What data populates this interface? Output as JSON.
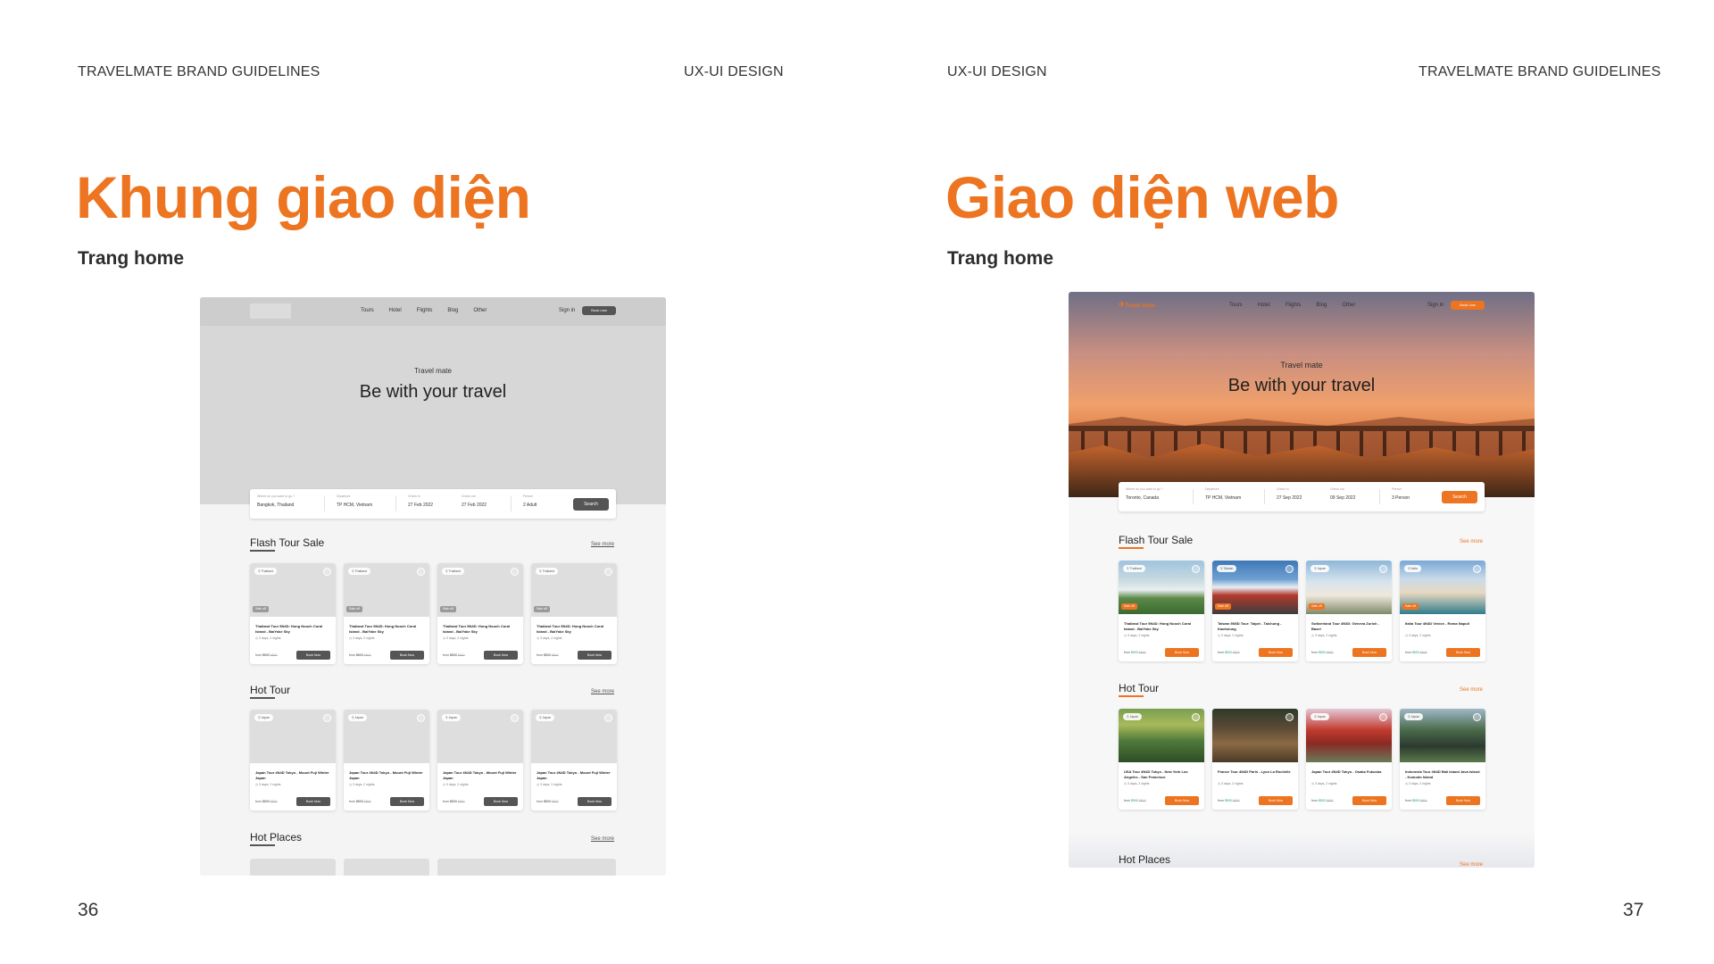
{
  "page": {
    "left": {
      "header_left": "TRAVELMATE BRAND GUIDELINES",
      "header_right": "UX-UI DESIGN",
      "title": "Khung giao diện",
      "subtitle": "Trang home",
      "page_number": "36"
    },
    "right": {
      "header_left": "UX-UI DESIGN",
      "header_right": "TRAVELMATE BRAND GUIDELINES",
      "title": "Giao diện web",
      "subtitle": "Trang home",
      "page_number": "37"
    }
  },
  "colors": {
    "accent": "#ed7420",
    "wire_dark": "#555555",
    "wire_hero": "#d7d7d7"
  },
  "mockup": {
    "nav": {
      "links": [
        "Tours",
        "Hotel",
        "Flights",
        "Blog",
        "Other"
      ],
      "sign_in": "Sign in",
      "book_now": "Book now",
      "logo_text": "Travel mate"
    },
    "hero": {
      "small_title": "Travel mate",
      "big_title": "Be with your travel"
    },
    "search_labels": [
      "Where do you want to go ?",
      "Departure",
      "Check in",
      "Check out",
      "Person"
    ],
    "search_button": "Search",
    "wire_search_values": [
      "Bangkok, Thailand",
      "TP HCM, Vietnam",
      "27 Feb 2022",
      "27 Feb 2022",
      "2 Adult"
    ],
    "web_search_values": [
      "Toronto, Canada",
      "TP HCM, Vietnam",
      "27 Sep 2022",
      "09 Sep 2022",
      "3 Person"
    ],
    "sections": {
      "flash": "Flash Tour Sale",
      "hot_tour": "Hot Tour",
      "hot_places": "Hot Places",
      "see_more": "See more"
    },
    "card_common": {
      "duration": "3 days, 2 nights",
      "from": "from",
      "price": "$500",
      "old_price": "$800",
      "sale": "Sale off",
      "book_btn": "Book Now"
    },
    "wire_flash_cards": [
      {
        "tag": "Thailand",
        "name": "Thailand Tour 5N4D: Hong Nooch Coral Island - BaiYoke Sky"
      },
      {
        "tag": "Thailand",
        "name": "Thailand Tour 5N4D: Hong Nooch Coral Island - BaiYoke Sky"
      },
      {
        "tag": "Thailand",
        "name": "Thailand Tour 5N4D: Hong Nooch Coral Island - BaiYoke Sky"
      },
      {
        "tag": "Thailand",
        "name": "Thailand Tour 5N4D: Hong Nooch Coral Island - BaiYoke Sky"
      }
    ],
    "wire_hot_cards": [
      {
        "tag": "Japan",
        "name": "Japan Tour 4N4D Tokyo - Mount Fuji Winter Japan"
      },
      {
        "tag": "Japan",
        "name": "Japan Tour 4N4D Tokyo - Mount Fuji Winter Japan"
      },
      {
        "tag": "Japan",
        "name": "Japan Tour 4N4D Tokyo - Mount Fuji Winter Japan"
      },
      {
        "tag": "Japan",
        "name": "Japan Tour 4N4D Tokyo - Mount Fuji Winter Japan"
      }
    ],
    "web_flash_cards": [
      {
        "tag": "Thailand",
        "name": "Thailand Tour 5N4D: Hong Nooch Coral Island - BaiYoke Sky",
        "img": "pagoda"
      },
      {
        "tag": "Taiwan",
        "name": "Taiwan 5N5D Tour: Taipei - Taichung - Kaohsiung",
        "img": "fuji"
      },
      {
        "tag": "Japan",
        "name": "Switzerland Tour 4N3D: Geneva Zurich - Basel",
        "img": "taj"
      },
      {
        "tag": "Italia",
        "name": "Italia Tour 4N4D Venice - Roma Napoli",
        "img": "venice"
      }
    ],
    "web_hot_cards": [
      {
        "tag": "Japan",
        "name": "USA Tour 4N4D Tokyo - New York Los Angeles - San Francisco",
        "img": "field"
      },
      {
        "tag": "",
        "name": "France Tour 4N4D Paris - Lyon La Rochelle",
        "img": "camel"
      },
      {
        "tag": "Japan",
        "name": "Japan Tour 4N4D Tokyo - Osaka Fukuoka",
        "img": "temple"
      },
      {
        "tag": "Japan",
        "name": "Indonesia Tour 4N4D Bali Island Java Island - Komodo Island",
        "img": "bali"
      }
    ]
  }
}
